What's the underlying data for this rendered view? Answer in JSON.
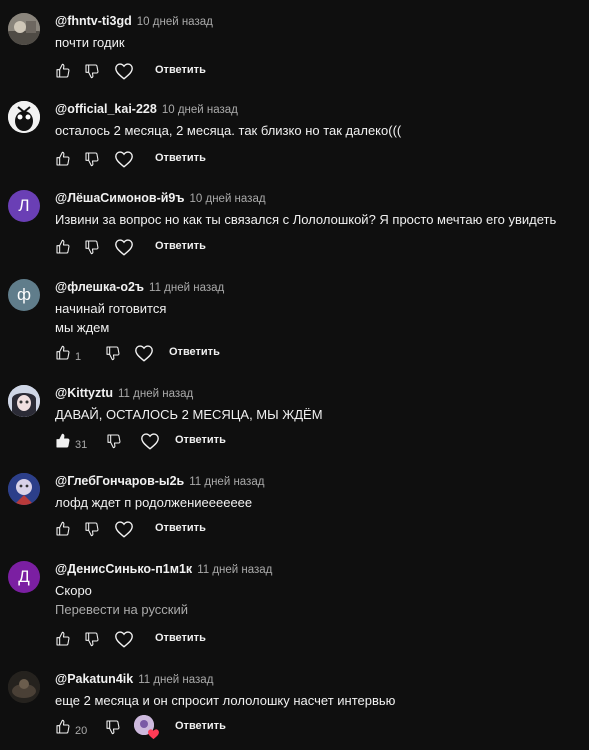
{
  "ui": {
    "reply_label": "Ответить"
  },
  "comments": [
    {
      "author": "@fhntv-ti3gd",
      "time": "10 дней назад",
      "lines": [
        "почти годик"
      ],
      "likes": "",
      "avatar_letter": "",
      "avatar_color": "#6f6a63",
      "avatar_icon": "photo-avatar-icon"
    },
    {
      "author": "@official_kai-228",
      "time": "10 дней назад",
      "lines": [
        "осталось 2 месяца, 2 месяца. так близко но так далеко((("
      ],
      "likes": "",
      "avatar_letter": "",
      "avatar_color": "#e8e8e8",
      "avatar_icon": "character-avatar-icon"
    },
    {
      "author": "@ЛёшаСимонов-й9ъ",
      "time": "10 дней назад",
      "lines": [
        "Извини за вопрос но как ты связался с Лололошкой? Я просто мечтаю его увидеть"
      ],
      "likes": "",
      "avatar_letter": "Л",
      "avatar_color": "#6a3fb5"
    },
    {
      "author": "@флешка-о2ъ",
      "time": "11 дней назад",
      "lines": [
        "начинай готовится",
        "мы ждем"
      ],
      "likes": "1",
      "avatar_letter": "ф",
      "avatar_color": "#607d8b"
    },
    {
      "author": "@Kittyztu",
      "time": "11 дней назад",
      "lines": [
        "ДАВАЙ, ОСТАЛОСЬ 2 МЕСЯЦА, МЫ ЖДЁМ"
      ],
      "likes": "31",
      "liked": true,
      "avatar_letter": "",
      "avatar_color": "#c8cfe0",
      "avatar_icon": "anime-avatar-icon"
    },
    {
      "author": "@ГлебГончаров-ы2ь",
      "time": "11 дней назад",
      "lines": [
        "лофд ждет п родолжениеееееее"
      ],
      "likes": "",
      "avatar_letter": "",
      "avatar_color": "#3b4a86",
      "avatar_icon": "art-avatar-icon"
    },
    {
      "author": "@ДенисСинько-п1м1к",
      "time": "11 дней назад",
      "lines": [
        "Скоро"
      ],
      "translate": "Перевести на русский",
      "likes": "",
      "avatar_letter": "Д",
      "avatar_color": "#7b1fa2"
    },
    {
      "author": "@Pakatun4ik",
      "time": "11 дней назад",
      "lines": [
        "еще 2 месяца и он спросит лололошку насчет интервью"
      ],
      "likes": "20",
      "creator_heart": true,
      "avatar_letter": "",
      "avatar_color": "#2e2a25",
      "avatar_icon": "dark-photo-avatar-icon"
    }
  ]
}
